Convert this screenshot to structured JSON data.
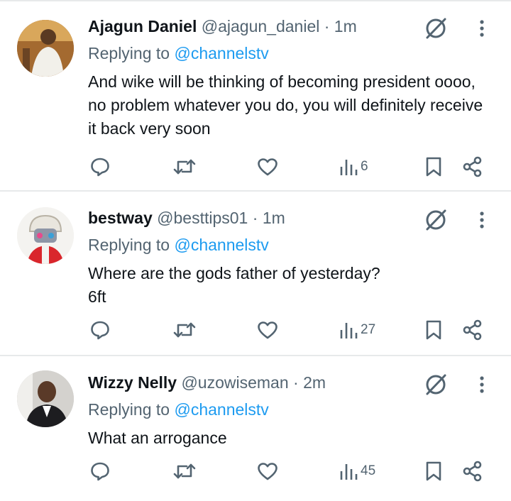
{
  "colors": {
    "text": "#0f1419",
    "muted": "#536471",
    "link": "#1d9bf0",
    "divider": "#e7e9ea",
    "icon": "#536471"
  },
  "icons": [
    "grok-icon",
    "more-icon",
    "reply-icon",
    "retweet-icon",
    "like-icon",
    "views-icon",
    "bookmark-icon",
    "share-icon"
  ],
  "tweets": [
    {
      "name": "Ajagun Daniel",
      "handle": "@ajagun_daniel",
      "sep": "·",
      "time": "1m",
      "reply_prefix": "Replying to",
      "reply_to": "@channelstv",
      "text": "And wike will be thinking of becoming president oooo, no problem whatever you do, you will definitely receive it back very soon",
      "views": "6"
    },
    {
      "name": "bestway",
      "handle": "@besttips01",
      "sep": "·",
      "time": "1m",
      "reply_prefix": "Replying to",
      "reply_to": "@channelstv",
      "text": "Where are the gods father of yesterday? 6ft",
      "views": "27"
    },
    {
      "name": "Wizzy Nelly",
      "handle": "@uzowiseman",
      "sep": "·",
      "time": "2m",
      "reply_prefix": "Replying to",
      "reply_to": "@channelstv",
      "text": "What an arrogance",
      "views": "45"
    }
  ]
}
